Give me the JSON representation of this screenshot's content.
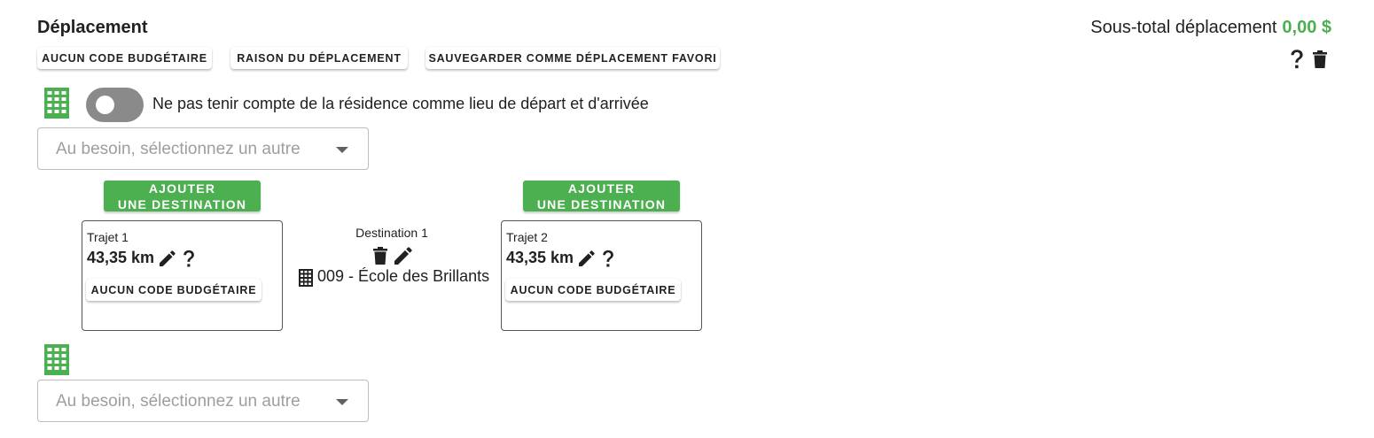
{
  "section": {
    "title": "Déplacement",
    "subtotal_label": "Sous-total déplacement",
    "subtotal_amount": "0,00 $"
  },
  "actions": {
    "no_budget_code": "Aucun code budgétaire",
    "reason": "Raison du déplacement",
    "save_favorite": "Sauvegarder comme déplacement favori"
  },
  "residence_toggle": {
    "label": "Ne pas tenir compte de la résidence comme lieu de départ et d'arrivée",
    "checked": false
  },
  "start_select": {
    "placeholder": "Au besoin, sélectionnez un autre"
  },
  "add_destination": {
    "line1": "Ajouter",
    "line2": "une destination"
  },
  "trips": [
    {
      "label": "Trajet 1",
      "distance": "43,35 km",
      "budget_button": "Aucun code budgétaire"
    },
    {
      "label": "Trajet 2",
      "distance": "43,35 km",
      "budget_button": "Aucun code budgétaire"
    }
  ],
  "destinations": [
    {
      "label": "Destination 1",
      "name": "009 - École des Brillants"
    }
  ],
  "end_select": {
    "placeholder": "Au besoin, sélectionnez un autre"
  },
  "colors": {
    "accent": "#4caf50",
    "toggle_off": "#8a8a8a",
    "text": "#212121"
  },
  "icons": [
    "building-icon",
    "pencil-icon",
    "help-icon",
    "trash-icon",
    "chevron-down-icon"
  ]
}
